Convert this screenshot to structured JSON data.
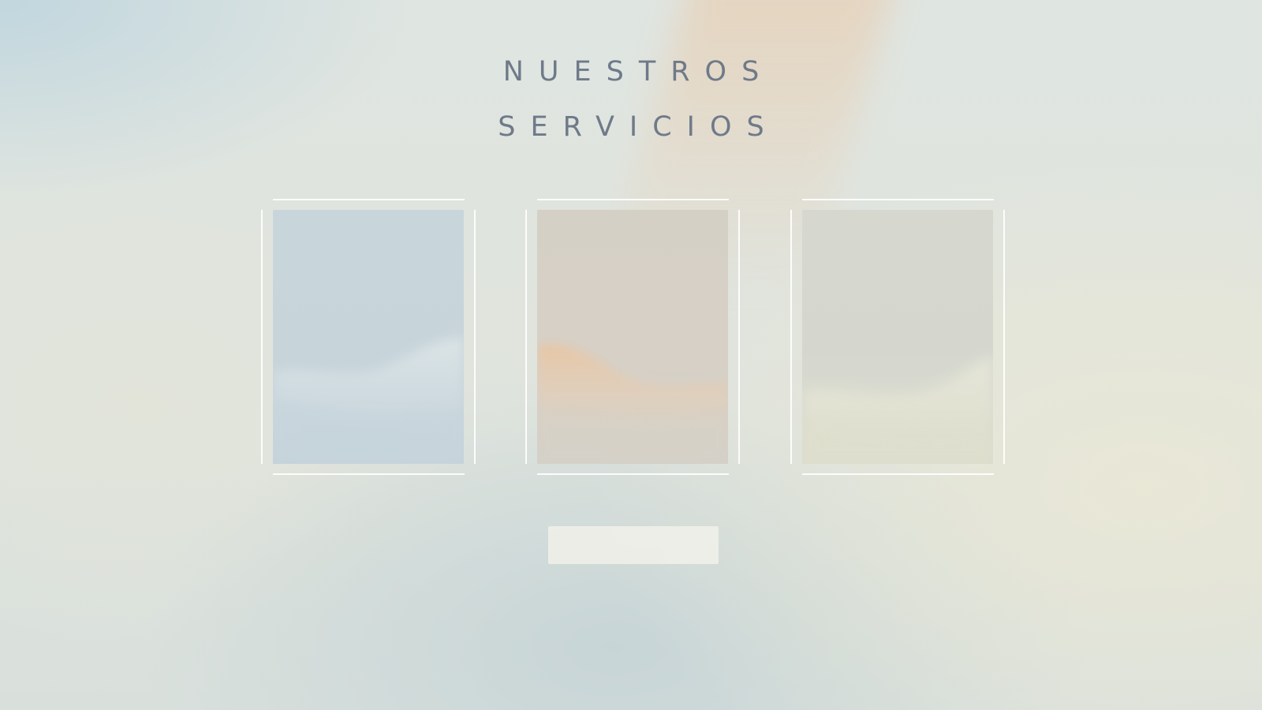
{
  "page": {
    "title_line_1": "NUESTROS",
    "title_line_2": "SERVICIOS"
  },
  "colors": {
    "title": "#6f7a89",
    "frame_line": "#ffffff",
    "button_fill": "#eeeee8"
  },
  "services": [
    {
      "accent": "#d7e1e4"
    },
    {
      "accent": "#e8c9a9"
    },
    {
      "accent": "#e4e6d6"
    }
  ],
  "cta": {
    "label": ""
  }
}
